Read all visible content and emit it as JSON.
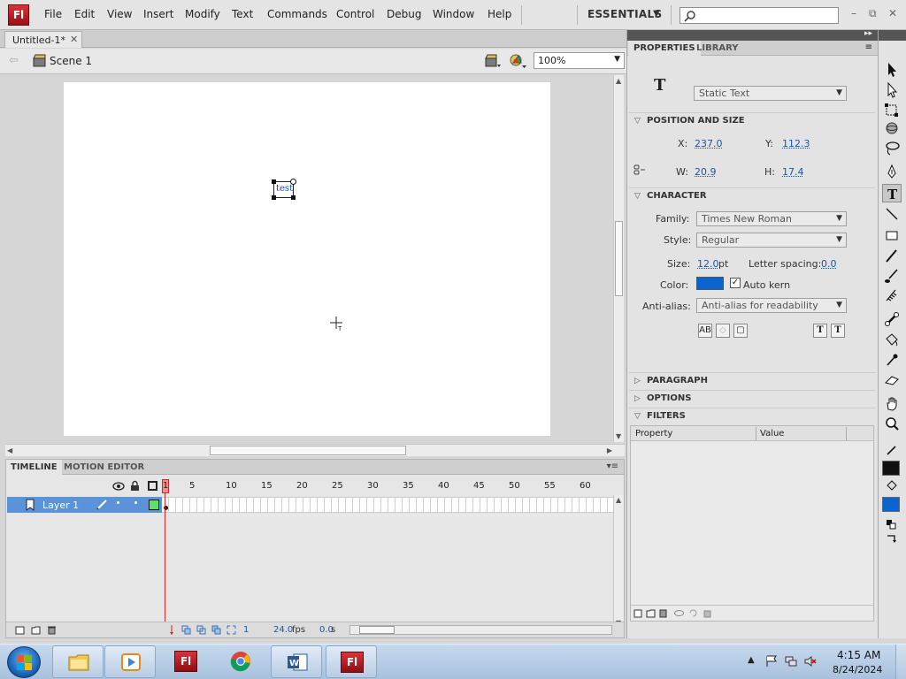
{
  "app": {
    "logo": "Fl",
    "menu": [
      "File",
      "Edit",
      "View",
      "Insert",
      "Modify",
      "Text",
      "Commands",
      "Control",
      "Debug",
      "Window",
      "Help"
    ],
    "workspace": "ESSENTIALS",
    "search_placeholder": "",
    "window_controls": [
      "–",
      "⧉",
      "✕"
    ]
  },
  "document": {
    "tab_label": "Untitled-1*",
    "scene": "Scene 1",
    "zoom": "100%"
  },
  "stage": {
    "text_object": "test",
    "background": "#ffffff"
  },
  "timeline": {
    "tabs": [
      "TIMELINE",
      "MOTION EDITOR"
    ],
    "frame_numbers": [
      "5",
      "10",
      "15",
      "20",
      "25",
      "30",
      "35",
      "40",
      "45",
      "50",
      "55",
      "60"
    ],
    "current_frame_label": "1",
    "layer_name": "Layer 1",
    "footer": {
      "current_frame": "1",
      "fps": "24.0",
      "fps_unit": "fps",
      "elapsed": "0.0",
      "elapsed_unit": "s"
    }
  },
  "properties": {
    "tabs": [
      "PROPERTIES",
      "LIBRARY"
    ],
    "text_type": "Static Text",
    "type_icon": "T",
    "sections": {
      "position": "POSITION AND SIZE",
      "character": "CHARACTER",
      "paragraph": "PARAGRAPH",
      "options": "OPTIONS",
      "filters": "FILTERS"
    },
    "position": {
      "x_label": "X:",
      "x": "237.0",
      "y_label": "Y:",
      "y": "112.3",
      "w_label": "W:",
      "w": "20.9",
      "h_label": "H:",
      "h": "17.4"
    },
    "character": {
      "family_label": "Family:",
      "family": "Times New Roman",
      "style_label": "Style:",
      "style": "Regular",
      "size_label": "Size:",
      "size": "12.0",
      "size_unit": "pt",
      "spacing_label": "Letter spacing:",
      "spacing": "0.0",
      "color_label": "Color:",
      "color": "#0a64cf",
      "autokern_label": "Auto kern",
      "autokern_checked": "✓",
      "antialias_label": "Anti-alias:",
      "antialias": "Anti-alias for readability"
    },
    "filters": {
      "col_property": "Property",
      "col_value": "Value"
    }
  },
  "tools": {
    "stroke_color": "#111111",
    "fill_color": "#0a64cf"
  },
  "taskbar": {
    "items": [
      "explorer",
      "media-player",
      "flash",
      "chrome",
      "word",
      "flash"
    ],
    "flash_label": "Fl",
    "time": "4:15 AM",
    "date": "8/24/2024"
  }
}
